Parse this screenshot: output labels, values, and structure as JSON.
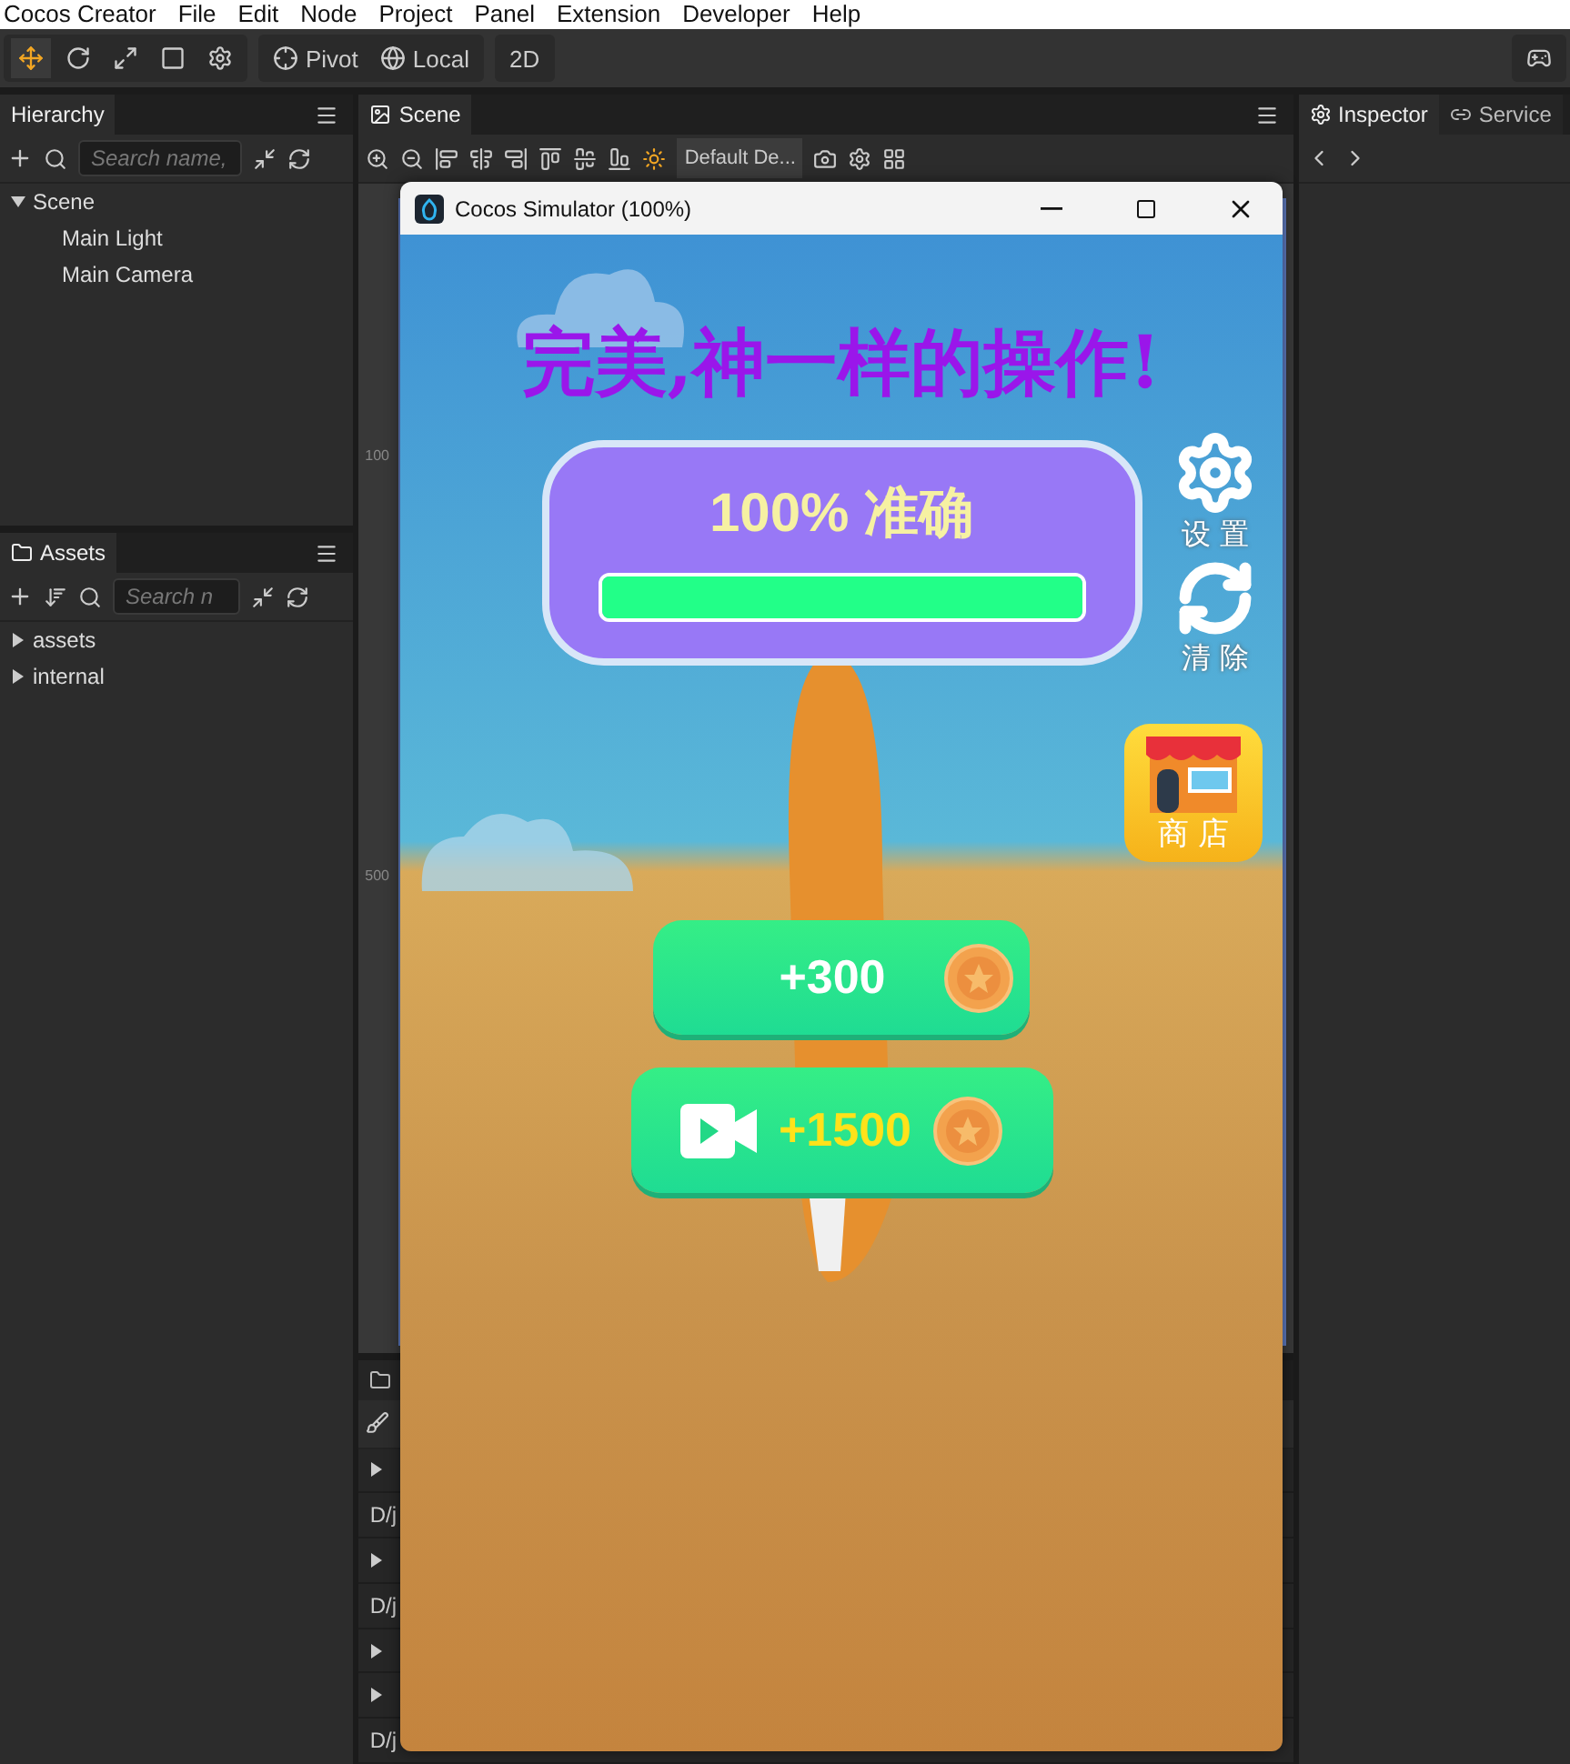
{
  "menu": [
    "Cocos Creator",
    "File",
    "Edit",
    "Node",
    "Project",
    "Panel",
    "Extension",
    "Developer",
    "Help"
  ],
  "toolbar": {
    "pivot": "Pivot",
    "local": "Local",
    "mode": "2D"
  },
  "hierarchy": {
    "title": "Hierarchy",
    "placeholder": "Search name,",
    "tree": [
      {
        "label": "Scene",
        "expanded": true,
        "children": [
          {
            "label": "Main Light"
          },
          {
            "label": "Main Camera"
          }
        ]
      }
    ]
  },
  "assets": {
    "title": "Assets",
    "placeholder": "Search n",
    "tree": [
      {
        "label": "assets",
        "expanded": false
      },
      {
        "label": "internal",
        "expanded": false
      }
    ]
  },
  "scene": {
    "title": "Scene",
    "camera": "Default De...",
    "rulers": [
      "100",
      "500"
    ]
  },
  "console": {
    "rows": [
      {
        "kind": "toggle"
      },
      {
        "kind": "path",
        "text": "D/j"
      },
      {
        "kind": "toggle"
      },
      {
        "kind": "path",
        "text": "D/j"
      },
      {
        "kind": "toggle"
      },
      {
        "kind": "toggle"
      },
      {
        "kind": "path",
        "text": "D/j"
      }
    ]
  },
  "right_tabs": [
    {
      "label": "Inspector",
      "selected": true
    },
    {
      "label": "Service",
      "selected": false
    }
  ],
  "simulator": {
    "title": "Cocos Simulator (100%)",
    "headline": "完美,神一样的操作!",
    "accuracy": "100% 准确",
    "level": 1,
    "side_buttons": [
      {
        "kind": "settings",
        "label": "设 置"
      },
      {
        "kind": "clear",
        "label": "清 除"
      }
    ],
    "shop": {
      "label": "商 店"
    },
    "rewards": [
      {
        "kind": "plain",
        "amount": "+300"
      },
      {
        "kind": "video",
        "amount": "+1500"
      }
    ]
  }
}
